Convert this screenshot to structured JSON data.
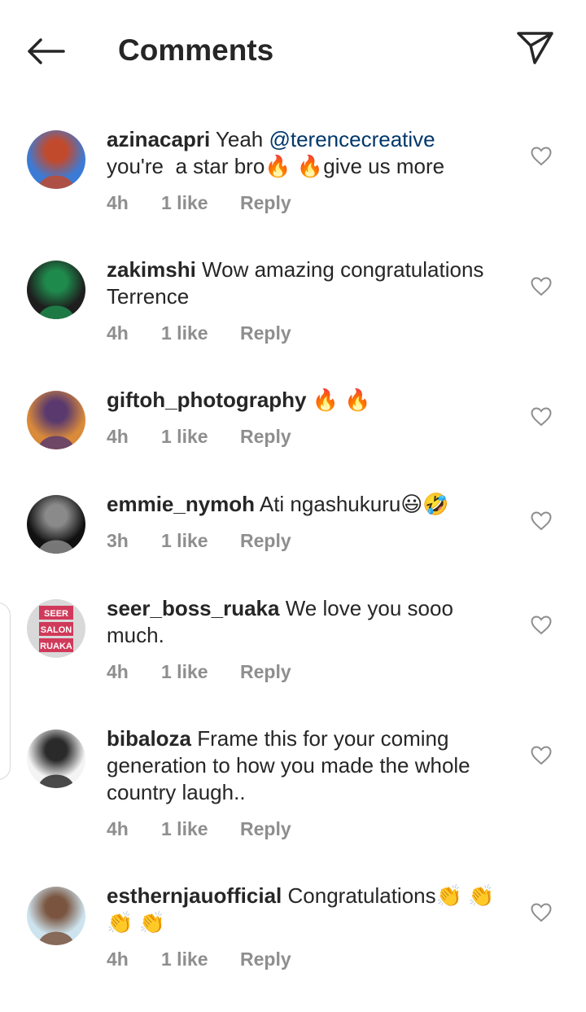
{
  "header": {
    "back_icon": "arrow-left-icon",
    "title": "Comments",
    "share_icon": "paper-plane-icon"
  },
  "comments": [
    {
      "username": "azinacapri",
      "text_before": " Yeah ",
      "mention": "@terencecreative",
      "text_after": "\nyou're  a star bro🔥 🔥give us more",
      "time": "4h",
      "likes": "1 like",
      "reply": "Reply",
      "avatar_colors": [
        "#3b7bd6",
        "#c24a2d"
      ]
    },
    {
      "username": "zakimshi",
      "text_before": " Wow amazing congratulations Terrence",
      "mention": "",
      "text_after": "",
      "time": "4h",
      "likes": "1 like",
      "reply": "Reply",
      "avatar_colors": [
        "#1e1e1e",
        "#1f8a4c"
      ]
    },
    {
      "username": "giftoh_photography",
      "text_before": " 🔥 🔥",
      "mention": "",
      "text_after": "",
      "time": "4h",
      "likes": "1 like",
      "reply": "Reply",
      "avatar_colors": [
        "#d98a3a",
        "#5a3a6e"
      ]
    },
    {
      "username": "emmie_nymoh",
      "text_before": " Ati ngashukuru😃🤣",
      "mention": "",
      "text_after": "",
      "time": "3h",
      "likes": "1 like",
      "reply": "Reply",
      "avatar_colors": [
        "#111111",
        "#8a8a8a"
      ]
    },
    {
      "username": "seer_boss_ruaka",
      "text_before": " We love you sooo much.",
      "mention": "",
      "text_after": "",
      "time": "4h",
      "likes": "1 like",
      "reply": "Reply",
      "avatar_colors": [
        "#d9d9d9",
        "#d0395a"
      ],
      "avatar_label": [
        "SEER",
        "SALON",
        "RUAKA"
      ]
    },
    {
      "username": "bibaloza",
      "text_before": " Frame this for your coming generation to how you made the whole country laugh..",
      "mention": "",
      "text_after": "",
      "time": "4h",
      "likes": "1 like",
      "reply": "Reply",
      "avatar_colors": [
        "#f4f4f4",
        "#2a2a2a"
      ]
    },
    {
      "username": "esthernjauofficial",
      "text_before": " Congratulations👏 👏\n👏 👏",
      "mention": "",
      "text_after": "",
      "time": "4h",
      "likes": "1 like",
      "reply": "Reply",
      "avatar_colors": [
        "#cde4ef",
        "#7a5540"
      ]
    }
  ],
  "like_icon": "heart-outline-icon",
  "colors": {
    "text": "#262626",
    "meta": "#8e8e8e",
    "mention": "#00376b",
    "background": "#ffffff"
  }
}
